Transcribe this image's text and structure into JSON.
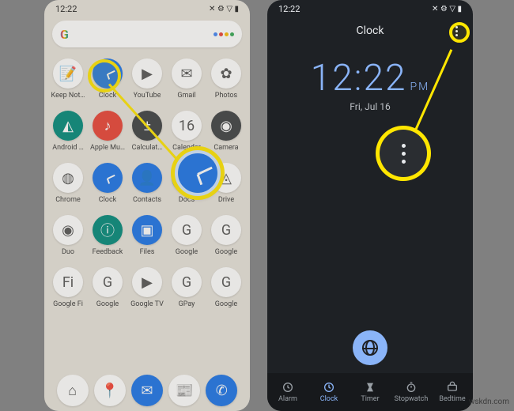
{
  "watermark": "wskdn.com",
  "left": {
    "status_time": "12:22",
    "status_icons": "✕ ⚙ ▽ ▮",
    "search_placeholder": "",
    "apps": [
      {
        "label": "Keep Not…",
        "color": "bg-white",
        "glyph": "📝"
      },
      {
        "label": "Clock",
        "color": "bg-blue",
        "glyph": "",
        "clock": true
      },
      {
        "label": "YouTube",
        "color": "bg-white",
        "glyph": "▶"
      },
      {
        "label": "Gmail",
        "color": "bg-white",
        "glyph": "✉"
      },
      {
        "label": "Photos",
        "color": "bg-white",
        "glyph": "✿"
      },
      {
        "label": "Android …",
        "color": "bg-teal",
        "glyph": "◭"
      },
      {
        "label": "Apple Mu…",
        "color": "bg-red",
        "glyph": "♪"
      },
      {
        "label": "Calculat…",
        "color": "bg-dark",
        "glyph": "±"
      },
      {
        "label": "Calendar",
        "color": "bg-white",
        "glyph": "16"
      },
      {
        "label": "Camera",
        "color": "bg-dark",
        "glyph": "◉"
      },
      {
        "label": "Chrome",
        "color": "bg-white",
        "glyph": "◍"
      },
      {
        "label": "Clock",
        "color": "bg-blue",
        "glyph": "",
        "clock": true
      },
      {
        "label": "Contacts",
        "color": "bg-blue",
        "glyph": "👤"
      },
      {
        "label": "Docs",
        "color": "bg-blue",
        "glyph": "▤"
      },
      {
        "label": "Drive",
        "color": "bg-white",
        "glyph": "◬"
      },
      {
        "label": "Duo",
        "color": "bg-white",
        "glyph": "◉"
      },
      {
        "label": "Feedback",
        "color": "bg-teal",
        "glyph": "ⓘ"
      },
      {
        "label": "Files",
        "color": "bg-blue",
        "glyph": "▣"
      },
      {
        "label": "Google",
        "color": "bg-white",
        "glyph": "G"
      },
      {
        "label": "Google",
        "color": "bg-white",
        "glyph": "G"
      },
      {
        "label": "Google Fi",
        "color": "bg-white",
        "glyph": "Fi"
      },
      {
        "label": "Google",
        "color": "bg-white",
        "glyph": "G"
      },
      {
        "label": "Google TV",
        "color": "bg-white",
        "glyph": "▶"
      },
      {
        "label": "GPay",
        "color": "bg-white",
        "glyph": "G"
      },
      {
        "label": "Google",
        "color": "bg-white",
        "glyph": "G"
      },
      {
        "label": "Home",
        "color": "bg-white",
        "glyph": "⌂"
      },
      {
        "label": "Maps",
        "color": "bg-white",
        "glyph": "📍"
      },
      {
        "label": "Messages",
        "color": "bg-blue",
        "glyph": "✉"
      },
      {
        "label": "News",
        "color": "bg-white",
        "glyph": "📰"
      },
      {
        "label": "Phone",
        "color": "bg-blue",
        "glyph": "✆"
      }
    ],
    "dock": [
      {
        "name": "home",
        "color": "bg-white",
        "glyph": "⌂"
      },
      {
        "name": "maps",
        "color": "bg-white",
        "glyph": "📍"
      },
      {
        "name": "messages",
        "color": "bg-blue",
        "glyph": "✉"
      },
      {
        "name": "news",
        "color": "bg-white",
        "glyph": "📰"
      },
      {
        "name": "phone",
        "color": "bg-blue",
        "glyph": "✆"
      }
    ]
  },
  "right": {
    "status_time": "12:22",
    "status_icons": "✕ ⚙ ▽ ▮",
    "header_title": "Clock",
    "time_hm": "12:22",
    "time_ampm": "PM",
    "date": "Fri, Jul 16",
    "nav": [
      {
        "label": "Alarm"
      },
      {
        "label": "Clock"
      },
      {
        "label": "Timer"
      },
      {
        "label": "Stopwatch"
      },
      {
        "label": "Bedtime"
      }
    ],
    "active_nav_index": 1
  }
}
